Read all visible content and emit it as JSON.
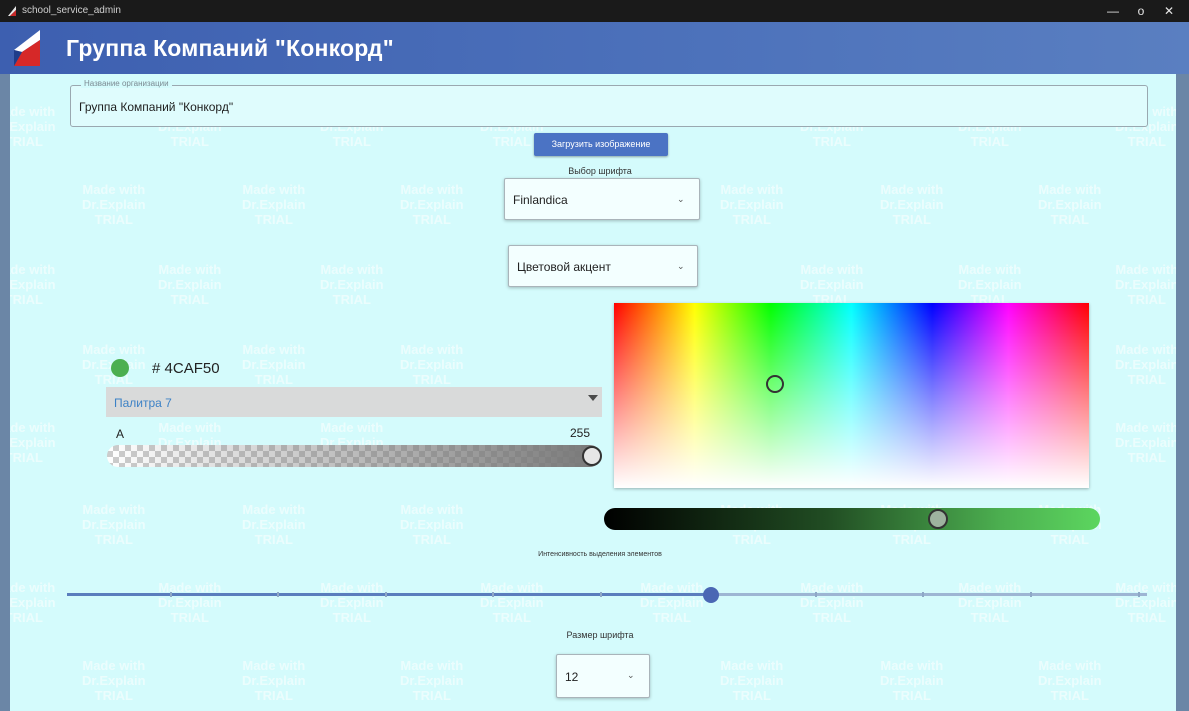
{
  "window": {
    "title": "school_service_admin",
    "minimize_glyph": "—",
    "restore_glyph": "o",
    "close_glyph": "✕"
  },
  "header": {
    "title": "Группа Компаний \"Конкорд\""
  },
  "watermark": {
    "line1": "Made with",
    "line2": "Dr.Explain",
    "line3": "TRIAL"
  },
  "form": {
    "org_name_label": "Название организации",
    "org_name_value": "Группа Компаний \"Конкорд\"",
    "upload_button": "Загрузить изображение",
    "font_choice_label": "Выбор шрифта",
    "font_value": "Finlandica",
    "accent_value": "Цветовой акцент",
    "intensity_label": "Интенсивность выделения элементов",
    "intensity_value": 0.6,
    "font_size_label": "Размер шрифта",
    "font_size_value": "12"
  },
  "color_picker": {
    "swatch_color": "#4CAF50",
    "hex_prefix": "#",
    "hex_value": "4CAF50",
    "palette_value": "Палитра 7",
    "alpha_label": "A",
    "alpha_value": "255"
  },
  "colors": {
    "accent": "#4CAF50",
    "header_bg": "#4d72bb",
    "panel_bg": "#d4fbfc",
    "button_bg": "#4b73c4"
  }
}
